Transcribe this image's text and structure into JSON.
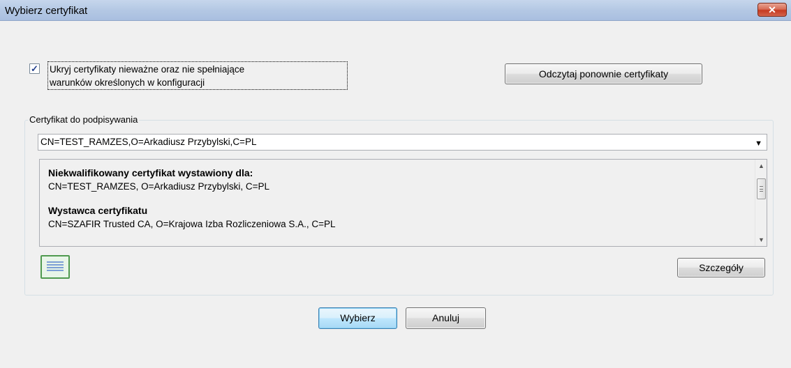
{
  "window": {
    "title": "Wybierz certyfikat",
    "close_glyph": "✕"
  },
  "options": {
    "hide_invalid_checked": true,
    "hide_invalid_label_line1": "Ukryj certyfikaty nieważne oraz nie spełniające",
    "hide_invalid_label_line2": "warunków określonych w konfiguracji",
    "reload_button": "Odczytaj ponownie certyfikaty"
  },
  "certificate_group": {
    "legend": "Certyfikat do podpisywania",
    "selected": "CN=TEST_RAMZES,O=Arkadiusz Przybylski,C=PL",
    "details": {
      "issued_to_heading": "Niekwalifikowany certyfikat wystawiony dla:",
      "issued_to_value": "CN=TEST_RAMZES, O=Arkadiusz Przybylski, C=PL",
      "issuer_heading": "Wystawca certyfikatu",
      "issuer_value": "CN=SZAFIR Trusted CA, O=Krajowa Izba Rozliczeniowa S.A., C=PL"
    },
    "details_button": "Szczegóły"
  },
  "actions": {
    "select_button": "Wybierz",
    "cancel_button": "Anuluj"
  },
  "icons": {
    "close": "close-icon",
    "checkbox": "checkmark-icon",
    "dropdown": "chevron-down-icon",
    "certificate": "certificate-icon"
  },
  "colors": {
    "titlebar": "#b9cce6",
    "close_button": "#c9452b",
    "default_button_border": "#3c7fb1"
  }
}
